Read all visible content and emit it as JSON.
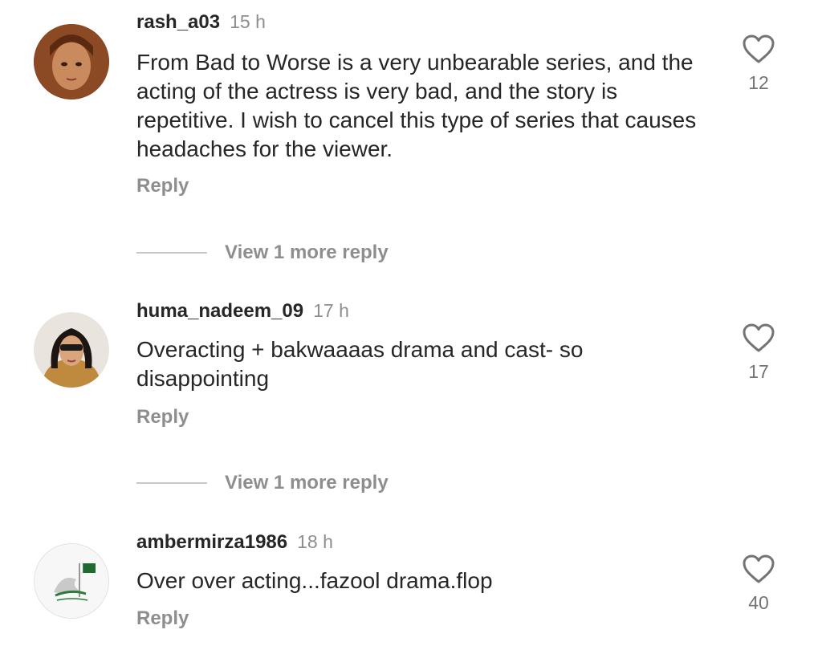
{
  "comments": [
    {
      "username": "rash_a03",
      "time": "15 h",
      "text": "From Bad to Worse is a very unbearable series, and the acting of the actress is very bad, and the story is repetitive. I wish to cancel this type of series that causes headaches for the viewer.",
      "reply_label": "Reply",
      "likes": "12",
      "view_replies": "View 1 more reply"
    },
    {
      "username": "huma_nadeem_09",
      "time": "17 h",
      "text": "Overacting + bakwaaaas drama and cast- so disappointing",
      "reply_label": "Reply",
      "likes": "17",
      "view_replies": "View 1 more reply"
    },
    {
      "username": "ambermirza1986",
      "time": "18 h",
      "text": "Over over acting...fazool drama.flop",
      "reply_label": "Reply",
      "likes": "40"
    }
  ],
  "icons": {
    "like": "heart-outline-icon"
  },
  "colors": {
    "username": "#262626",
    "muted": "#8e8e8e",
    "divider": "#c7c7c7"
  }
}
